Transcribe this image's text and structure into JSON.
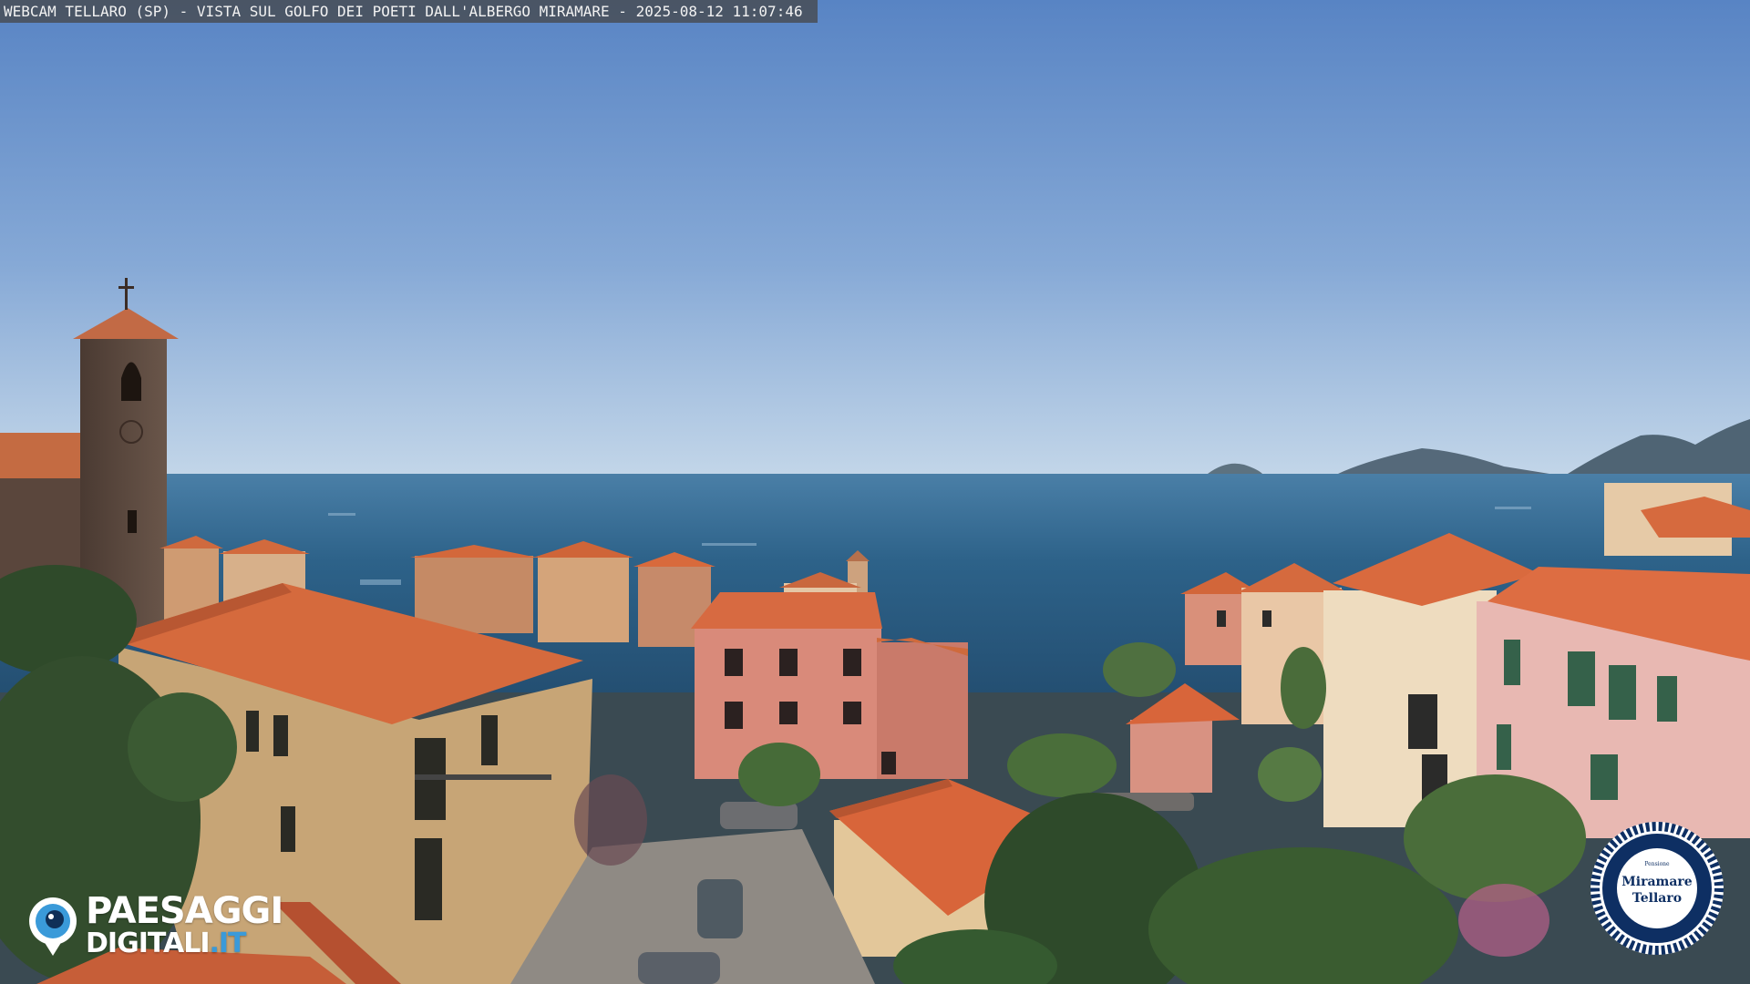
{
  "overlay": {
    "caption": "WEBCAM TELLARO (SP) - VISTA SUL GOLFO DEI POETI DALL'ALBERGO MIRAMARE - 2025-08-12 11:07:46"
  },
  "brand": {
    "line1": "PAESAGGI",
    "line2_main": "DIGITALI",
    "line2_tld": ".IT",
    "icon": "eye-logo-icon"
  },
  "seal": {
    "name_line1": "Miramare",
    "name_line2": "Tellaro",
    "small_top": "Pensione",
    "icon": "rope-ring-seal"
  },
  "colors": {
    "sky_top": "#5f8ac6",
    "sky_horizon": "#c3d8ea",
    "sea": "#2c5f86",
    "roof": "#d8643a",
    "logo_blue": "#3a9ad9",
    "seal_navy": "#0e2f63"
  }
}
